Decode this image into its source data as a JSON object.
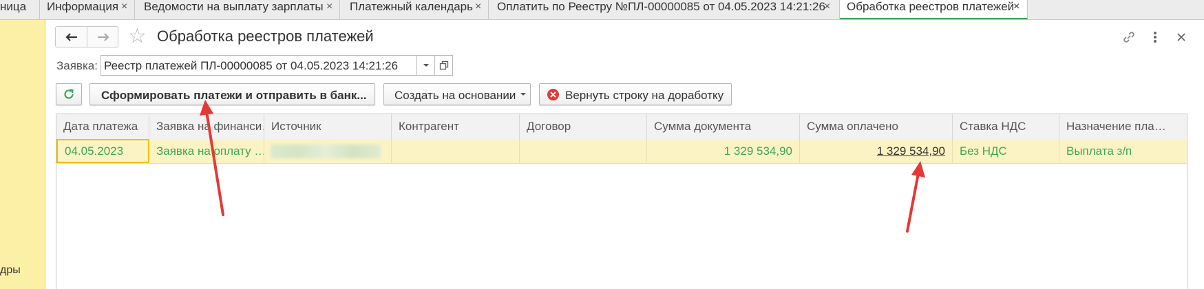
{
  "tabs": [
    {
      "label": "ница",
      "closable": false,
      "active": false
    },
    {
      "label": "Информация",
      "closable": true,
      "active": false
    },
    {
      "label": "Ведомости на выплату зарплаты",
      "closable": true,
      "active": false
    },
    {
      "label": "Платежный календарь",
      "closable": true,
      "active": false
    },
    {
      "label": "Оплатить по Реестру №ПЛ-00000085 от 04.05.2023 14:21:26",
      "closable": true,
      "active": false
    },
    {
      "label": "Обработка реестров платежей",
      "closable": true,
      "active": true
    }
  ],
  "tab_close_glyph": "×",
  "left_panel": {
    "label": "дры"
  },
  "header": {
    "title": "Обработка реестров платежей",
    "back_icon": "arrow-left-icon",
    "forward_icon": "arrow-right-icon",
    "star_icon": "star-outline-icon",
    "link_icon": "link-icon",
    "more_icon": "more-vertical-icon",
    "close_icon": "close-icon"
  },
  "request_field": {
    "label": "Заявка:",
    "value": "Реестр платежей ПЛ-00000085 от 04.05.2023 14:21:26"
  },
  "toolbar": {
    "refresh_icon": "refresh-icon",
    "form_button": "Сформировать платежи и отправить в банк...",
    "create_button": "Создать на основании",
    "return_button": "Вернуть строку на доработку",
    "return_icon": "error-circle-icon"
  },
  "table": {
    "columns": [
      "Дата платежа",
      "Заявка на финанси…",
      "Источник",
      "Контрагент",
      "Договор",
      "Сумма документа",
      "Сумма оплачено",
      "Ставка НДС",
      "Назначение пла…"
    ],
    "rows": [
      {
        "date": "04.05.2023",
        "request": "Заявка на оплату …",
        "source": "",
        "counterparty": "",
        "contract": "",
        "doc_sum": "1 329 534,90",
        "paid_sum": "1 329 534,90",
        "vat": "Без НДС",
        "purpose": "Выплата з/п"
      }
    ]
  },
  "colors": {
    "accent_green": "#3aa65a",
    "row_highlight": "#fbf3c3",
    "selection_border": "#f0c000",
    "left_panel": "#fbf0a6",
    "annotation_arrow": "#e53935"
  }
}
